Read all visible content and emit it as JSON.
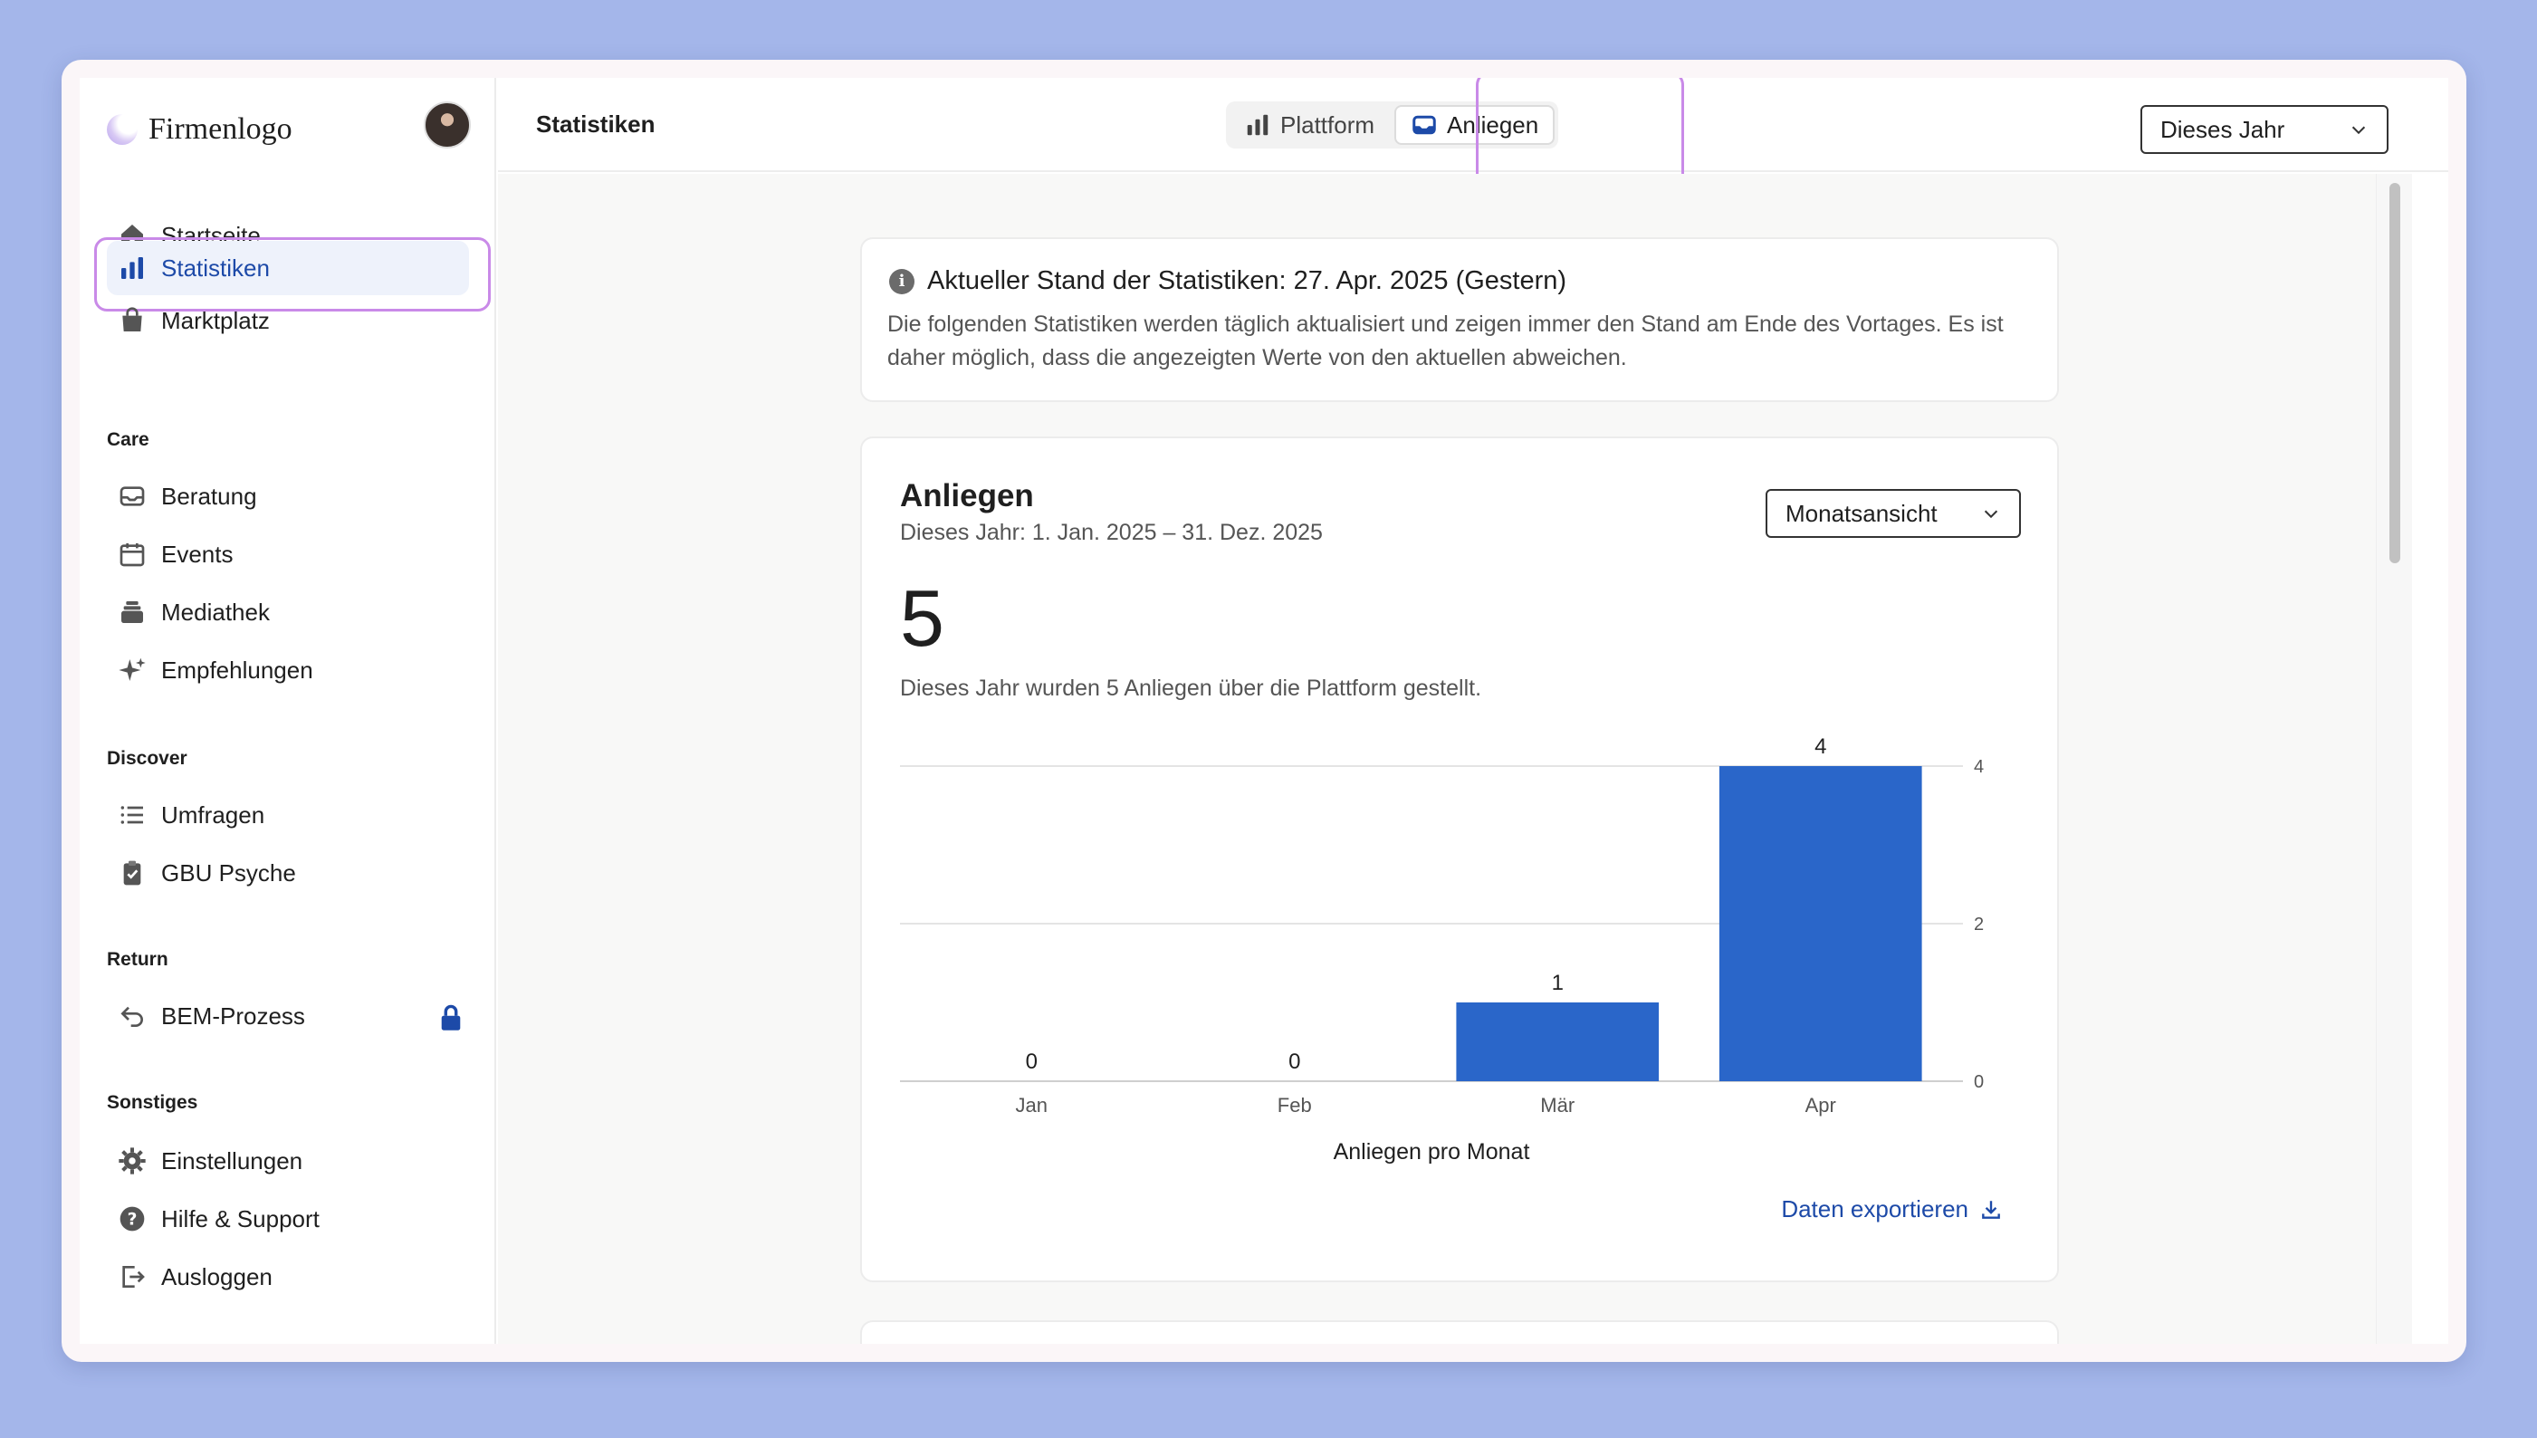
{
  "brand": {
    "name": "Firmenlogo"
  },
  "sidebar": {
    "items": [
      {
        "label": "Startseite"
      },
      {
        "label": "Statistiken"
      },
      {
        "label": "Marktplatz"
      }
    ],
    "sections": [
      {
        "title": "Care",
        "items": [
          {
            "label": "Beratung"
          },
          {
            "label": "Events"
          },
          {
            "label": "Mediathek"
          },
          {
            "label": "Empfehlungen"
          }
        ]
      },
      {
        "title": "Discover",
        "items": [
          {
            "label": "Umfragen"
          },
          {
            "label": "GBU Psyche"
          }
        ]
      },
      {
        "title": "Return",
        "items": [
          {
            "label": "BEM-Prozess"
          }
        ]
      },
      {
        "title": "Sonstiges",
        "items": [
          {
            "label": "Einstellungen"
          },
          {
            "label": "Hilfe & Support"
          },
          {
            "label": "Ausloggen"
          }
        ]
      }
    ]
  },
  "header": {
    "title": "Statistiken",
    "tabs": [
      {
        "label": "Plattform"
      },
      {
        "label": "Anliegen"
      }
    ],
    "period_select": "Dieses Jahr"
  },
  "info": {
    "title": "Aktueller Stand der Statistiken: 27. Apr. 2025 (Gestern)",
    "text": "Die folgenden Statistiken werden täglich aktualisiert und zeigen immer den Stand am Ende des Vortages. Es ist daher möglich, dass die angezeigten Werte von den aktuellen abweichen."
  },
  "stats_card": {
    "title": "Anliegen",
    "range": "Dieses Jahr: 1. Jan. 2025 – 31. Dez. 2025",
    "view_select": "Monatsansicht",
    "total": "5",
    "description": "Dieses Jahr wurden 5 Anliegen über die Plattform gestellt.",
    "export_label": "Daten exportieren"
  },
  "chart_data": {
    "type": "bar",
    "categories": [
      "Jan",
      "Feb",
      "Mär",
      "Apr"
    ],
    "values": [
      0,
      0,
      1,
      4
    ],
    "xlabel": "Anliegen pro Monat",
    "ylabel": "",
    "ylim": [
      0,
      4
    ],
    "yticks": [
      0,
      2,
      4
    ],
    "y_axis_side": "right",
    "grid": true,
    "bar_color": "#2a66c9",
    "data_labels": true
  },
  "colors": {
    "accent": "#1d4aa8",
    "bar": "#2a66c9",
    "highlight": "#c98ae8",
    "background": "#a4b6ea"
  }
}
